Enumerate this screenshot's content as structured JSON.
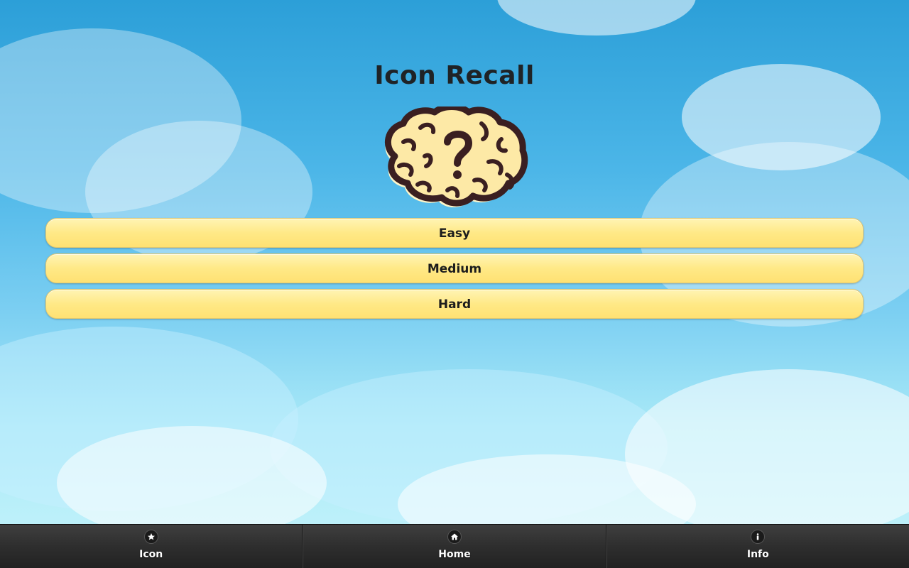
{
  "app": {
    "title": "Icon Recall"
  },
  "logo": {
    "icon": "brain-question-icon",
    "colors": {
      "outline": "#3a1f21",
      "fill": "#fde9a6",
      "shadow": "#fff6c9"
    }
  },
  "menu": {
    "levels": [
      {
        "label": "Easy"
      },
      {
        "label": "Medium"
      },
      {
        "label": "Hard"
      }
    ],
    "button_color": "#ffe57f"
  },
  "tabbar": {
    "tabs": [
      {
        "label": "Icon",
        "icon": "star-icon"
      },
      {
        "label": "Home",
        "icon": "home-icon"
      },
      {
        "label": "Info",
        "icon": "info-icon"
      }
    ]
  },
  "theme": {
    "sky_top": "#2c9fd8",
    "sky_bottom": "#c6f4fb",
    "tabbar_bg": "#2e2e2e"
  }
}
